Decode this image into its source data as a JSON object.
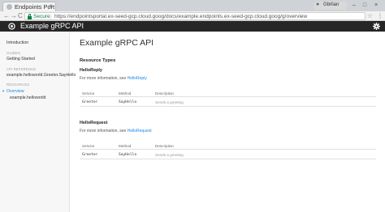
{
  "browser": {
    "tab_title": "Endpoints Port",
    "tab_close": "×",
    "profile_label": "Gbrlian",
    "win_minimize": "–",
    "win_maximize": "□",
    "win_close": "×",
    "nav_back": "←",
    "nav_forward": "→",
    "nav_reload": "C",
    "secure_label": "Secure",
    "url_separator": "|",
    "url": "https://endpointsportal.ex-seed-gcp.cloud.goog/docs/example.endpoints.ex-seed-gcp.cloud.goog/g/overview",
    "star": "☆",
    "menu": "⋮"
  },
  "app": {
    "title": "Example gRPC API"
  },
  "sidebar": {
    "introduction": "Introduction",
    "guides_heading": "GUIDES",
    "getting_started": "Getting Started",
    "api_reference_heading": "API REFERENCE",
    "greeter_item": "example.helloworld.Greeter.SayHello",
    "resources_heading": "RESOURCES",
    "overview_caret": "▾",
    "overview": "Overview",
    "helloworld": "example.helloworld"
  },
  "main": {
    "page_title": "Example gRPC API",
    "resource_types_heading": "Resource Types",
    "types": [
      {
        "name": "HelloReply",
        "info_prefix": "For more information, see ",
        "info_link": "HelloReply",
        "headers": {
          "service": "Service",
          "method": "Method",
          "description": "Description"
        },
        "row": {
          "service": "Greeter",
          "method": "SayHello",
          "description": "Sends a greeting"
        }
      },
      {
        "name": "HelloRequest",
        "info_prefix": "For more information, see ",
        "info_link": "HelloRequest",
        "headers": {
          "service": "Service",
          "method": "Method",
          "description": "Description"
        },
        "row": {
          "service": "Greeter",
          "method": "SayHello",
          "description": "Sends a greeting"
        }
      }
    ]
  }
}
